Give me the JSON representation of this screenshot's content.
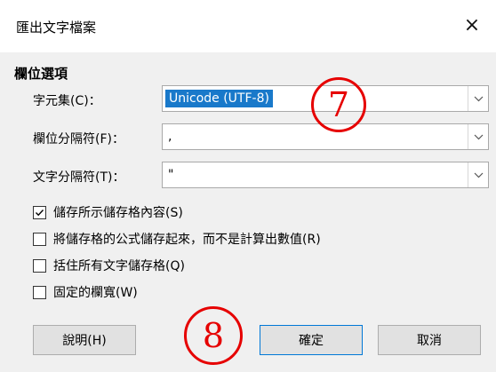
{
  "dialog": {
    "title": "匯出文字檔案",
    "close_glyph": "×"
  },
  "field_options": {
    "section_label": "欄位選項",
    "charset_label": "字元集(C)：",
    "charset_value": "Unicode (UTF-8)",
    "field_sep_label": "欄位分隔符(F)：",
    "field_sep_value": ",",
    "text_sep_label": "文字分隔符(T)：",
    "text_sep_value": "\""
  },
  "checkboxes": [
    {
      "label": "儲存所示儲存格內容(S)",
      "checked": true
    },
    {
      "label": "將儲存格的公式儲存起來，而不是計算出數值(R)",
      "checked": false
    },
    {
      "label": "括住所有文字儲存格(Q)",
      "checked": false
    },
    {
      "label": "固定的欄寬(W)",
      "checked": false
    }
  ],
  "buttons": {
    "help": "說明(H)",
    "ok": "確定",
    "cancel": "取消"
  },
  "annotations": {
    "step7": "⑦",
    "step8": "⑧",
    "color": "#e60000"
  },
  "icons": {
    "dropdown": "chevron-down-icon",
    "close": "close-icon",
    "check": "check-icon"
  }
}
